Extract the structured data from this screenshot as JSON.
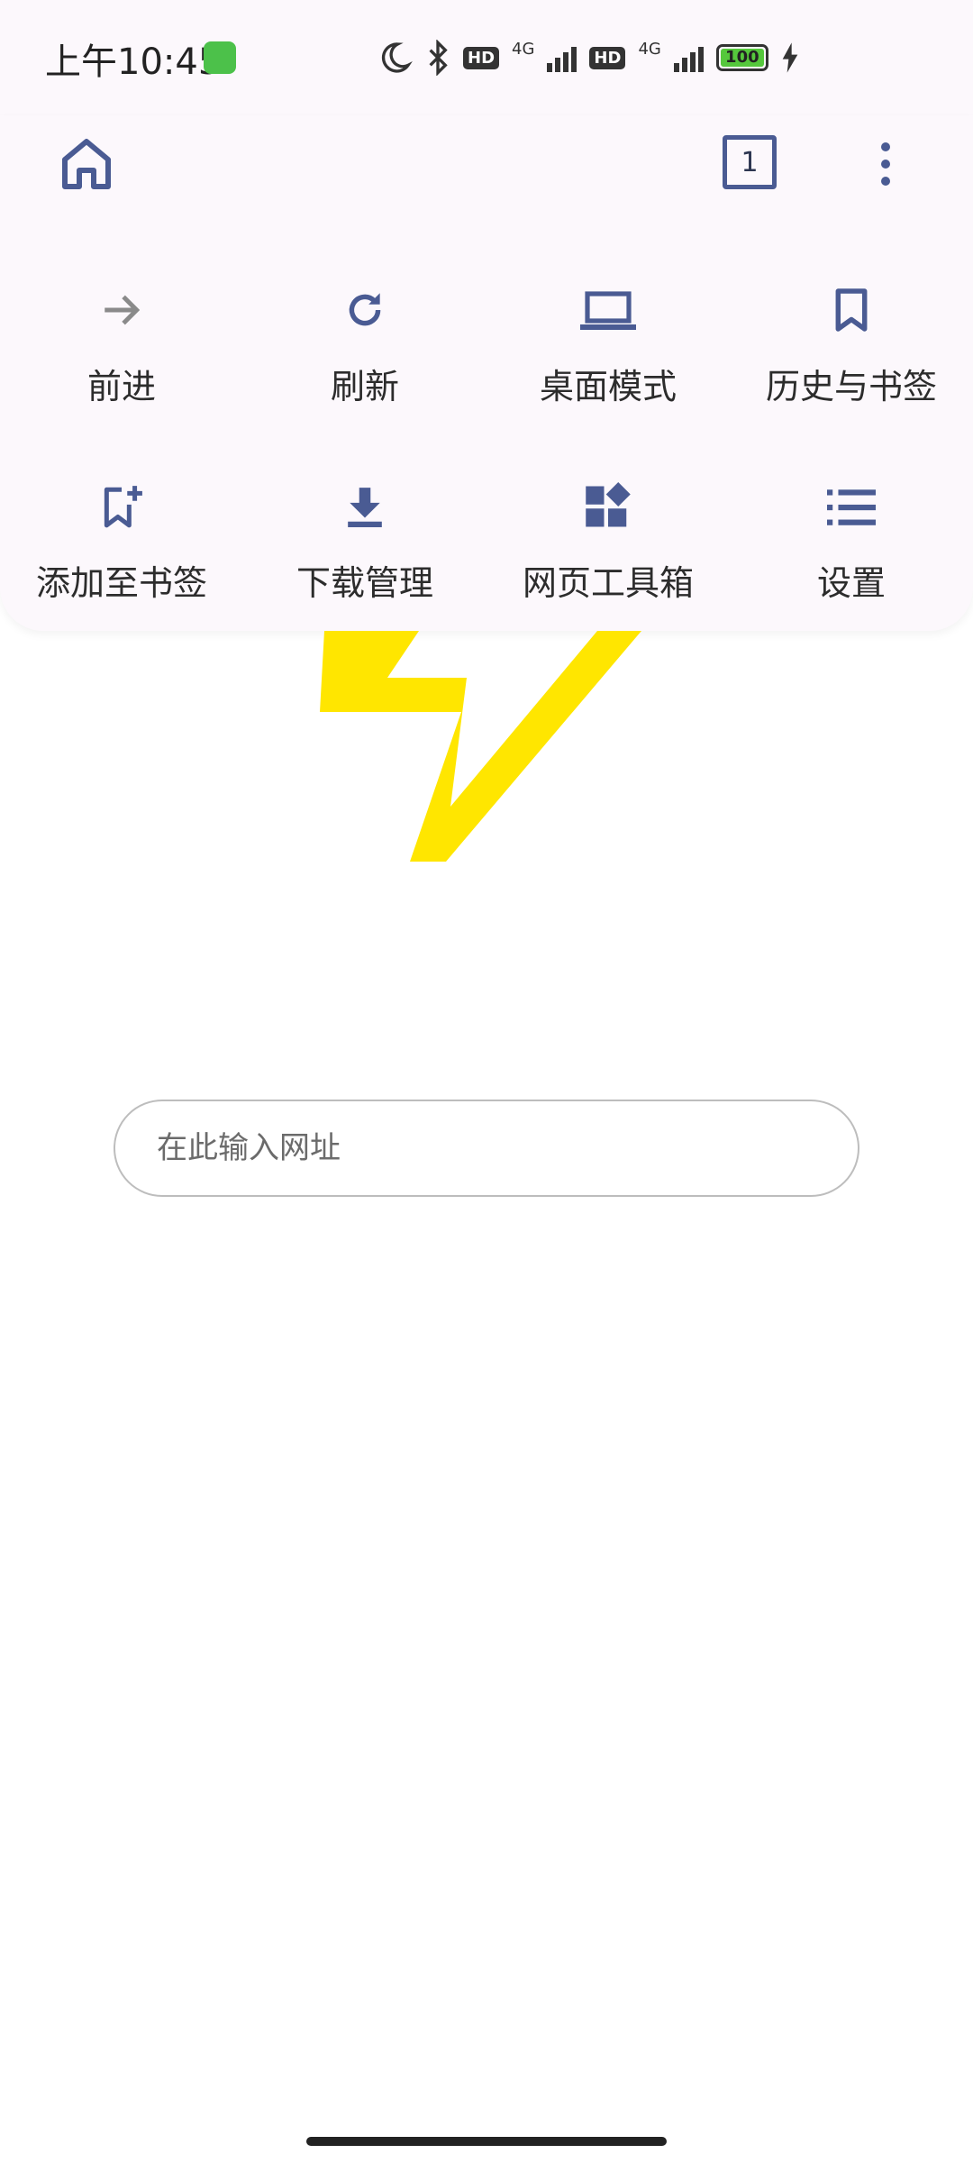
{
  "status_bar": {
    "time": "上午10:45",
    "network_1": "4G",
    "network_2": "4G",
    "hd_1": "HD",
    "hd_2": "HD",
    "battery": "100"
  },
  "toolbar": {
    "tab_count": "1"
  },
  "menu": {
    "items": [
      {
        "label": "前进",
        "icon": "arrow-right-icon"
      },
      {
        "label": "刷新",
        "icon": "refresh-icon"
      },
      {
        "label": "桌面模式",
        "icon": "laptop-icon"
      },
      {
        "label": "历史与书签",
        "icon": "bookmark-icon"
      },
      {
        "label": "添加至书签",
        "icon": "bookmark-add-icon"
      },
      {
        "label": "下载管理",
        "icon": "download-icon"
      },
      {
        "label": "网页工具箱",
        "icon": "widgets-icon"
      },
      {
        "label": "设置",
        "icon": "list-settings-icon"
      }
    ]
  },
  "search": {
    "placeholder": "在此输入网址",
    "value": ""
  },
  "colors": {
    "accent": "#4a5b93",
    "logo": "#ffe600",
    "panel_bg": "#fcf8fc"
  }
}
